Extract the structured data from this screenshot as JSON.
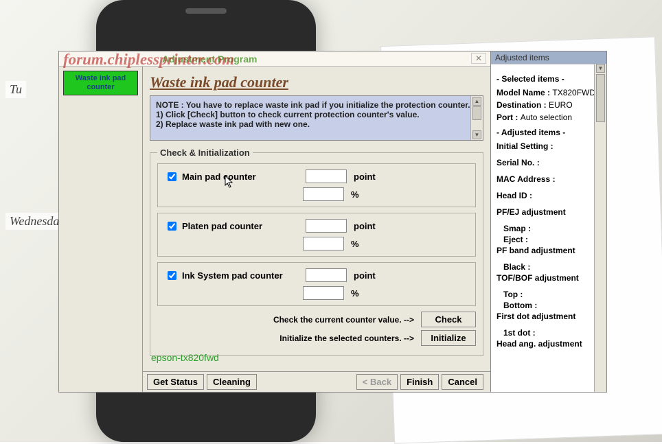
{
  "background": {
    "weekday_top": "Tu",
    "weekday_mid": "Wednesda"
  },
  "watermark_url": "forum.chiplessprinter.com",
  "window": {
    "title_suffix": "Adjustment Program",
    "close_glyph": "✕",
    "sidebar": {
      "waste_btn": "Waste ink pad counter"
    },
    "page_title": "Waste ink pad counter",
    "note": {
      "line1": "NOTE : You have to replace waste ink pad if you initialize the protection counter.",
      "line2": "1) Click [Check] button to check current protection counter's value.",
      "line3": "2) Replace waste ink pad with new one."
    },
    "group_legend": "Check & Initialization",
    "counters": {
      "main": {
        "label": "Main pad counter",
        "checked": true,
        "point": "",
        "pct": ""
      },
      "platen": {
        "label": "Platen pad counter",
        "checked": true,
        "point": "",
        "pct": ""
      },
      "ink": {
        "label": "Ink System pad counter",
        "checked": true,
        "point": "",
        "pct": ""
      },
      "unit_point": "point",
      "unit_pct": "%"
    },
    "actions": {
      "check_prompt": "Check the current counter value. -->",
      "check_btn": "Check",
      "init_prompt": "Initialize the selected counters. -->",
      "init_btn": "Initialize"
    },
    "watermark2": "epson-tx820fwd",
    "bottom": {
      "get_status": "Get Status",
      "cleaning": "Cleaning",
      "back": "< Back",
      "finish": "Finish",
      "cancel": "Cancel"
    }
  },
  "right": {
    "header": "Adjusted items",
    "selected_hdr": "- Selected items -",
    "model_k": "Model Name :",
    "model_v": "TX820FWD",
    "dest_k": "Destination :",
    "dest_v": "EURO",
    "port_k": "Port :",
    "port_v": "Auto selection",
    "adjusted_hdr": "- Adjusted items -",
    "items": [
      "Initial Setting :",
      "Serial No. :",
      "MAC Address :",
      "Head ID :",
      "PF/EJ adjustment",
      "  Smap :",
      "  Eject :",
      "PF band adjustment",
      "  Black :",
      "TOF/BOF adjustment",
      "  Top :",
      "  Bottom :",
      "First dot adjustment",
      "  1st dot :",
      "Head ang. adjustment"
    ]
  }
}
